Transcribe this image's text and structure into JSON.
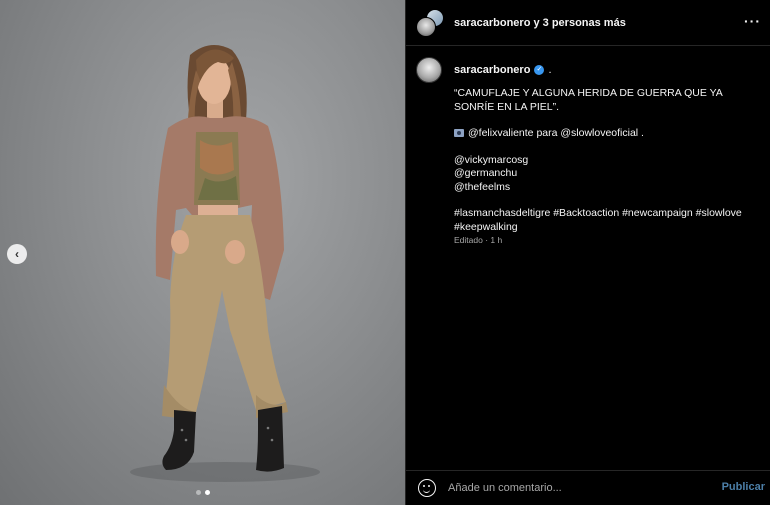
{
  "header": {
    "username": "saracarbonero",
    "collab_suffix": " y 3 personas más",
    "more_icon": "more-horizontal-icon",
    "more_glyph": "···"
  },
  "carousel": {
    "prev_glyph": "‹",
    "slide_count": 2,
    "active_slide": 2
  },
  "post": {
    "author": "saracarbonero",
    "verified": true,
    "author_suffix": ".",
    "caption": {
      "line1": "“CAMUFLAJE Y ALGUNA HERIDA DE GUERRA QUE YA SONRÍE EN LA PIEL”.",
      "credit": "@felixvaliente para @slowloveoficial .",
      "tags": [
        "@vickymarcosg",
        "@germanchu",
        "@thefeelms"
      ],
      "hashtags": "#lasmanchasdeltigre #Backtoaction #newcampaign #slowlove #keepwalking"
    },
    "meta": "Editado · 1 h"
  },
  "footer": {
    "placeholder": "Añade un comentario...",
    "post_label": "Publicar",
    "emoji_icon": "emoji-icon"
  },
  "colors": {
    "background": "#000000",
    "text": "#f5f5f5",
    "muted": "#a8a8a8",
    "verified": "#3897f0",
    "post_button": "#4c7fa8"
  }
}
